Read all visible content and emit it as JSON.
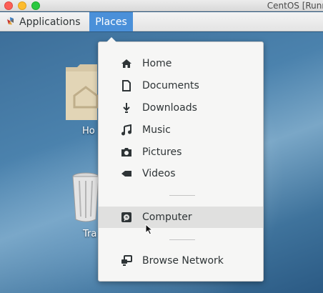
{
  "window": {
    "title": "CentOS [Runn",
    "controls": [
      "close",
      "minimize",
      "zoom"
    ]
  },
  "topbar": {
    "applications_label": "Applications",
    "places_label": "Places"
  },
  "desktop": {
    "icons": [
      {
        "label": "Ho",
        "icon": "home-folder-icon"
      },
      {
        "label": "Tra",
        "icon": "trash-icon"
      }
    ]
  },
  "places_menu": {
    "items": [
      {
        "label": "Home",
        "icon": "home-icon"
      },
      {
        "label": "Documents",
        "icon": "document-icon"
      },
      {
        "label": "Downloads",
        "icon": "download-icon"
      },
      {
        "label": "Music",
        "icon": "music-icon"
      },
      {
        "label": "Pictures",
        "icon": "camera-icon"
      },
      {
        "label": "Videos",
        "icon": "video-icon"
      }
    ],
    "computer": {
      "label": "Computer",
      "icon": "drive-icon",
      "hovered": true
    },
    "network": {
      "label": "Browse Network",
      "icon": "network-icon"
    }
  },
  "colors": {
    "places_highlight": "#4a90d9",
    "menu_background": "#f6f6f5",
    "hover_row": "#e0e0df"
  }
}
